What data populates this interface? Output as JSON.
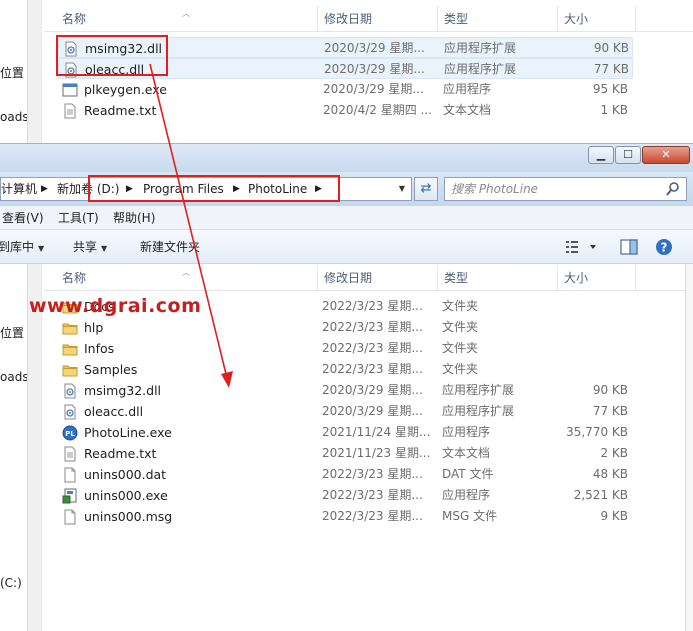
{
  "top_window": {
    "left_pane": [
      "位置",
      "oads"
    ],
    "columns": {
      "name": "名称",
      "date": "修改日期",
      "type": "类型",
      "size": "大小"
    },
    "files": [
      {
        "name": "msimg32.dll",
        "date": "2020/3/29 星期...",
        "type": "应用程序扩展",
        "size": "90 KB",
        "icon": "dll-icon"
      },
      {
        "name": "oleacc.dll",
        "date": "2020/3/29 星期...",
        "type": "应用程序扩展",
        "size": "77 KB",
        "icon": "dll-icon"
      },
      {
        "name": "plkeygen.exe",
        "date": "2020/3/29 星期...",
        "type": "应用程序",
        "size": "95 KB",
        "icon": "exe-icon"
      },
      {
        "name": "Readme.txt",
        "date": "2020/4/2 星期四 ...",
        "type": "文本文档",
        "size": "1 KB",
        "icon": "txt-icon"
      }
    ]
  },
  "front_window": {
    "window_controls": {
      "minimize": "▁",
      "maximize": "☐",
      "close": "✕"
    },
    "breadcrumb": [
      "计算机",
      "新加卷 (D:)",
      "Program Files",
      "PhotoLine"
    ],
    "search": {
      "placeholder": "搜索 PhotoLine"
    },
    "menu": [
      "查看(V)",
      "工具(T)",
      "帮助(H)"
    ],
    "toolbar": {
      "include": "到库中",
      "share": "共享",
      "new_folder": "新建文件夹"
    },
    "left_pane": [
      "位置",
      "oads",
      "(C:)"
    ],
    "columns": {
      "name": "名称",
      "date": "修改日期",
      "type": "类型",
      "size": "大小"
    },
    "files": [
      {
        "name": "Docs",
        "date": "2022/3/23 星期...",
        "type": "文件夹",
        "size": "",
        "icon": "folder-icon"
      },
      {
        "name": "hlp",
        "date": "2022/3/23 星期...",
        "type": "文件夹",
        "size": "",
        "icon": "folder-icon"
      },
      {
        "name": "Infos",
        "date": "2022/3/23 星期...",
        "type": "文件夹",
        "size": "",
        "icon": "folder-icon"
      },
      {
        "name": "Samples",
        "date": "2022/3/23 星期...",
        "type": "文件夹",
        "size": "",
        "icon": "folder-icon"
      },
      {
        "name": "msimg32.dll",
        "date": "2020/3/29 星期...",
        "type": "应用程序扩展",
        "size": "90 KB",
        "icon": "dll-icon"
      },
      {
        "name": "oleacc.dll",
        "date": "2020/3/29 星期...",
        "type": "应用程序扩展",
        "size": "77 KB",
        "icon": "dll-icon"
      },
      {
        "name": "PhotoLine.exe",
        "date": "2021/11/24 星期...",
        "type": "应用程序",
        "size": "35,770 KB",
        "icon": "photoline-icon"
      },
      {
        "name": "Readme.txt",
        "date": "2021/11/23 星期...",
        "type": "文本文档",
        "size": "2 KB",
        "icon": "txt-icon"
      },
      {
        "name": "unins000.dat",
        "date": "2022/3/23 星期...",
        "type": "DAT 文件",
        "size": "48 KB",
        "icon": "file-icon"
      },
      {
        "name": "unins000.exe",
        "date": "2022/3/23 星期...",
        "type": "应用程序",
        "size": "2,521 KB",
        "icon": "uninstall-icon"
      },
      {
        "name": "unins000.msg",
        "date": "2022/3/23 星期...",
        "type": "MSG 文件",
        "size": "9 KB",
        "icon": "file-icon"
      }
    ]
  },
  "watermark": "www.dgrai.com",
  "colors": {
    "annotation_red": "#e02020",
    "watermark": "#c81e1e",
    "folder": "#e8c15a"
  }
}
